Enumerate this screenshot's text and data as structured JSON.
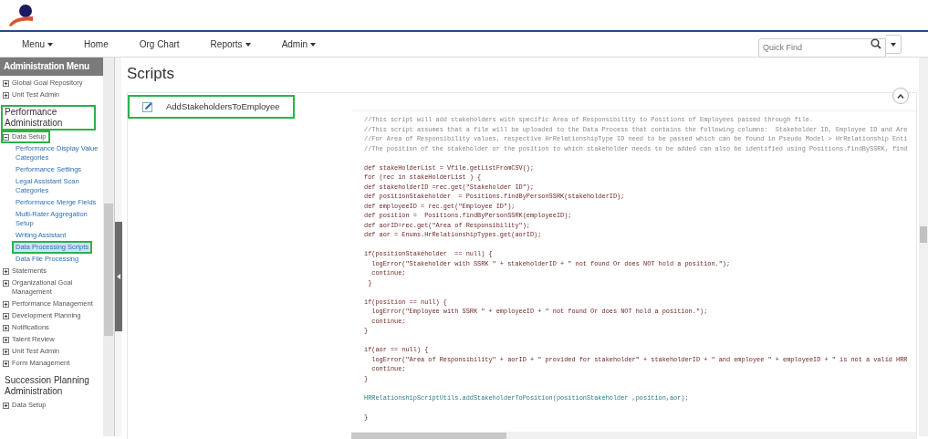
{
  "nav": {
    "items": [
      {
        "label": "Menu",
        "dropdown": true
      },
      {
        "label": "Home",
        "dropdown": false
      },
      {
        "label": "Org Chart",
        "dropdown": false
      },
      {
        "label": "Reports",
        "dropdown": true
      },
      {
        "label": "Admin",
        "dropdown": true
      }
    ],
    "search": {
      "placeholder": "Quick Find"
    }
  },
  "sidebar": {
    "title": "Administration Menu",
    "groups": [
      {
        "items": [
          {
            "label": "Global Goal Repository",
            "expanded": false
          },
          {
            "label": "Unit Test Admin",
            "expanded": false
          }
        ]
      },
      {
        "heading": "Performance Administration",
        "highlighted": true,
        "items": [
          {
            "label": "Data Setup",
            "expanded": true,
            "highlighted": true,
            "children": [
              {
                "label": "Performance Display Value Categories",
                "selected": false,
                "highlighted": false
              },
              {
                "label": "Performance Settings",
                "selected": false,
                "highlighted": false
              },
              {
                "label": "Legal Assistant Scan Categories",
                "selected": false,
                "highlighted": false
              },
              {
                "label": "Performance Merge Fields",
                "selected": false,
                "highlighted": false
              },
              {
                "label": "Multi-Rater Aggregation Setup",
                "selected": false,
                "highlighted": false
              },
              {
                "label": "Writing Assistant",
                "selected": false,
                "highlighted": false
              },
              {
                "label": "Data Processing Scripts",
                "selected": true,
                "highlighted": true
              },
              {
                "label": "Data File Processing",
                "selected": false,
                "highlighted": false
              }
            ]
          },
          {
            "label": "Statements",
            "expanded": false
          },
          {
            "label": "Organizational Goal Management",
            "expanded": false
          },
          {
            "label": "Performance Management",
            "expanded": false
          },
          {
            "label": "Development Planning",
            "expanded": false
          },
          {
            "label": "Notifications",
            "expanded": false
          },
          {
            "label": "Talent Review",
            "expanded": false
          },
          {
            "label": "Unit Test Admin",
            "expanded": false
          },
          {
            "label": "Form Management",
            "expanded": false
          }
        ]
      },
      {
        "heading": "Succession Planning Administration",
        "highlighted": false,
        "items": [
          {
            "label": "Data Setup",
            "expanded": false
          }
        ]
      }
    ]
  },
  "page": {
    "title": "Scripts"
  },
  "script": {
    "name": "AddStakeholdersToEmployee",
    "highlighted": true,
    "code_blocks": [
      [
        {
          "kind": "comment",
          "text": "//This script will add stakeholders with specific Area of Responsibility to Positions of Employees passed through file."
        },
        {
          "kind": "comment",
          "text": "//This script assumes that a file will be uploaded to the Data Process that contains the following columns:  Stakeholder ID, Employee ID and Are"
        },
        {
          "kind": "comment",
          "text": "//For Area of Responsibility values, respective HrRelationshipType ID need to be passed which can be found in Pseudo Model > HrRelationship Enti"
        },
        {
          "kind": "comment",
          "text": "//The position of the stakeholder or the position to which stakeholder needs to be added can also be identified using Positions.findBySSRK, find"
        }
      ],
      [
        {
          "kind": "code",
          "text": "def stakeHolderList = Vfile.getListFromCSV();"
        },
        {
          "kind": "code",
          "text": "for (rec in stakeHolderList ) {"
        },
        {
          "kind": "code",
          "text": "def stakeholderID =rec.get(\"Stakeholder ID\");"
        },
        {
          "kind": "code",
          "text": "def positionStakeholder  = Positions.findByPersonSSRK(stakeholderID);"
        },
        {
          "kind": "code",
          "text": "def employeeID = rec.get(\"Employee ID\");"
        },
        {
          "kind": "code",
          "text": "def position =  Positions.findByPersonSSRK(employeeID);"
        },
        {
          "kind": "code",
          "text": "def aorID=rec.get(\"Area of Responsibility\");"
        },
        {
          "kind": "code",
          "text": "def aor = Enums.HrRelationshipTypes.get(aorID);"
        }
      ],
      [
        {
          "kind": "code",
          "text": "if(positionStakeholder  == null) {"
        },
        {
          "kind": "code",
          "text": "  logError(\"Stakeholder with SSRK \" + stakeholderID + \" not found Or does NOT hold a position.\");"
        },
        {
          "kind": "code",
          "text": "  continue;"
        },
        {
          "kind": "code",
          "text": " }"
        }
      ],
      [
        {
          "kind": "code",
          "text": "if(position == null) {"
        },
        {
          "kind": "code",
          "text": "  logError(\"Employee with SSRK \" + employeeID + \" not found Or does NOT hold a position.\");"
        },
        {
          "kind": "code",
          "text": "  continue;"
        },
        {
          "kind": "code",
          "text": "}"
        }
      ],
      [
        {
          "kind": "code",
          "text": "if(aor == null) {"
        },
        {
          "kind": "code",
          "text": "  logError(\"Area of Responsibility\" + aorID + \" provided for stakeholder\" + stakeholderID + \" and employee \" + employeeID + \" is not a valid HRR"
        },
        {
          "kind": "code",
          "text": "  continue;"
        },
        {
          "kind": "code",
          "text": "}"
        }
      ],
      [
        {
          "kind": "call",
          "text": "HRRelationshipScriptUtils.addStakeholderToPosition(positionStakeholder ,position,aor);"
        }
      ],
      [
        {
          "kind": "code",
          "text": "}"
        }
      ]
    ]
  }
}
